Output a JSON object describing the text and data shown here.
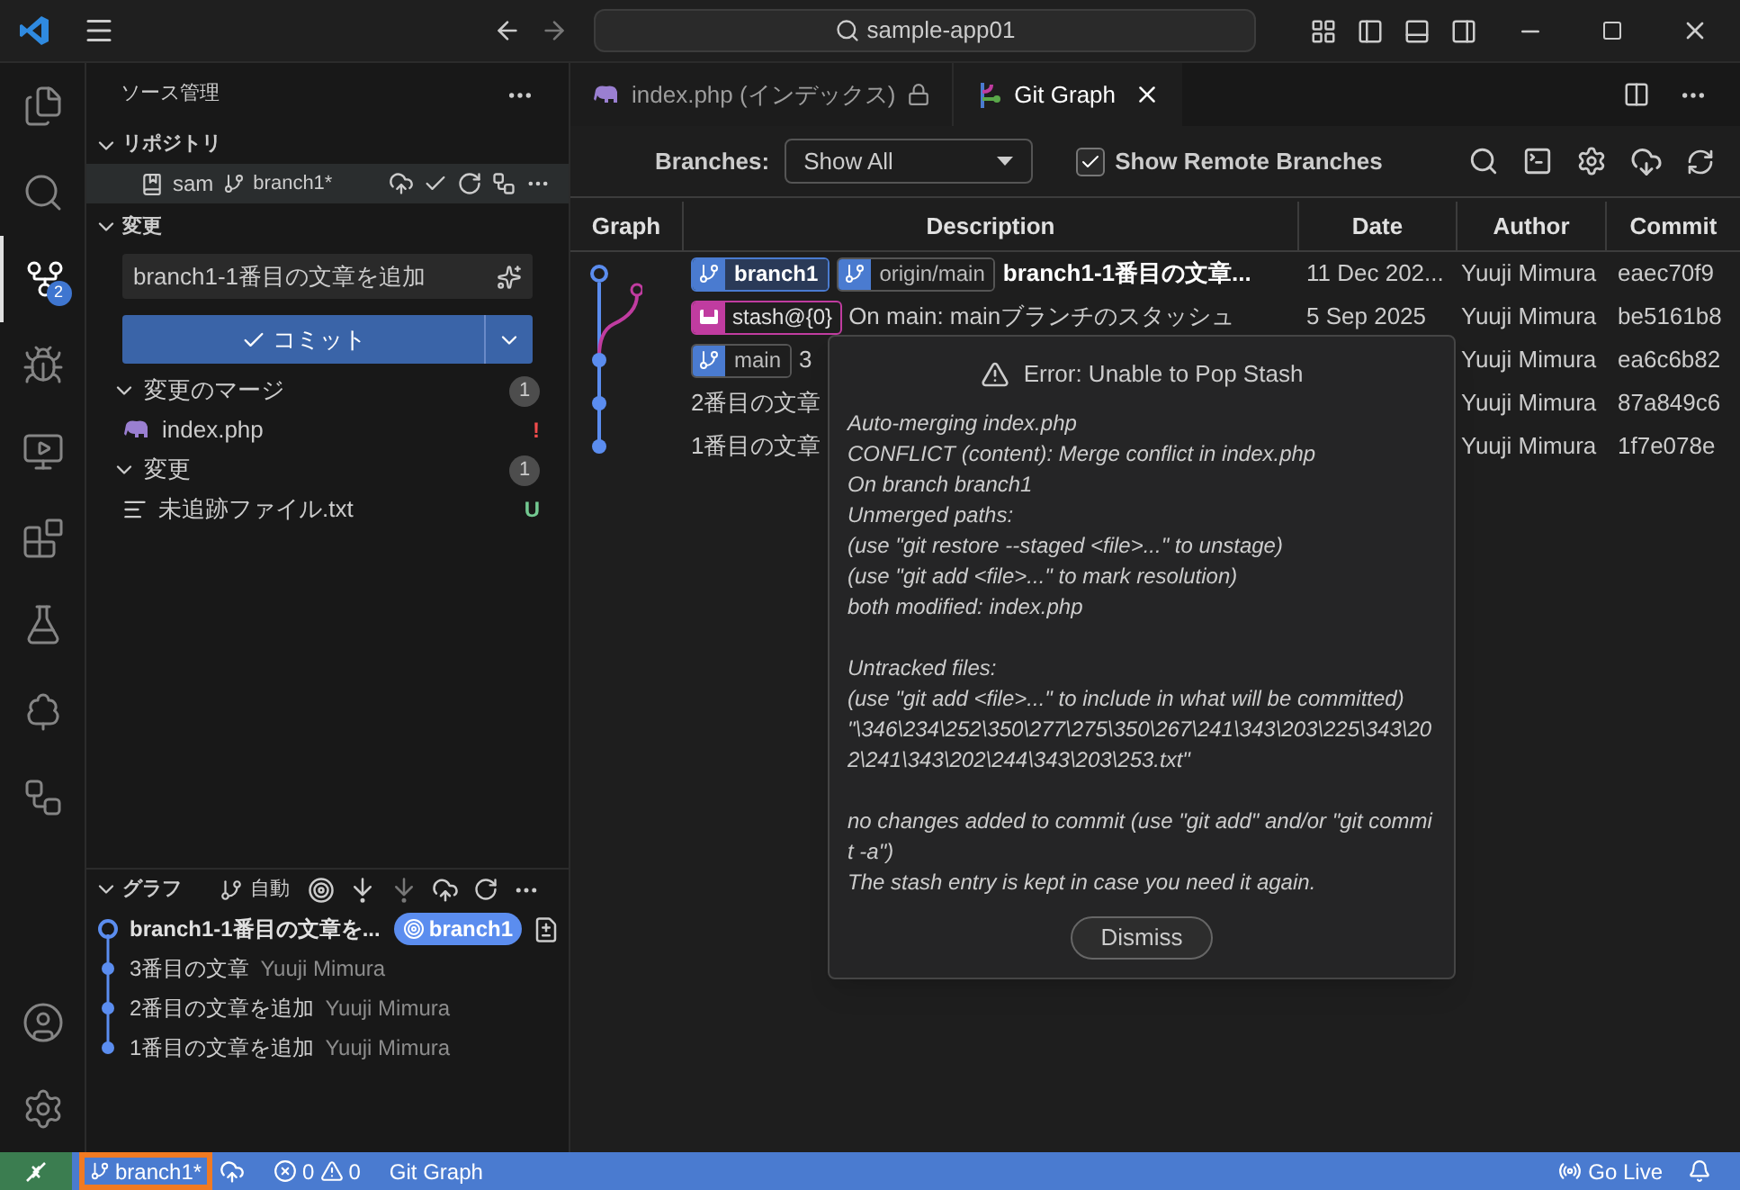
{
  "title_bar": {
    "search": "sample-app01"
  },
  "activity_bar": {
    "items": [
      {
        "kind": "files",
        "selected": false
      },
      {
        "kind": "search",
        "selected": false
      },
      {
        "kind": "source-control",
        "selected": true,
        "badge": "2"
      },
      {
        "kind": "debug",
        "selected": false
      },
      {
        "kind": "remote",
        "selected": false
      },
      {
        "kind": "extensions",
        "selected": false
      },
      {
        "kind": "testing",
        "selected": false
      },
      {
        "kind": "tree",
        "selected": false
      },
      {
        "kind": "diagram",
        "selected": false
      }
    ],
    "bottom": [
      {
        "kind": "account"
      },
      {
        "kind": "settings"
      }
    ]
  },
  "sidebar": {
    "title": "ソース管理",
    "repositories": {
      "label": "リポジトリ",
      "expanded": true,
      "repo": {
        "name": "sam",
        "branch": "branch1*"
      }
    },
    "changes": {
      "label": "変更",
      "expanded": true,
      "message": "branch1-1番目の文章を追加",
      "commit_button": "コミット",
      "groups": [
        {
          "label": "変更のマージ",
          "count": "1",
          "expanded": true,
          "files": [
            {
              "name": "index.php",
              "kind": "php",
              "status": "!",
              "color": "#f14c4c"
            }
          ]
        },
        {
          "label": "変更",
          "count": "1",
          "expanded": true,
          "files": [
            {
              "name": "未追跡ファイル.txt",
              "kind": "text",
              "status": "U",
              "color": "#73c991"
            }
          ]
        }
      ]
    },
    "graph": {
      "label": "グラフ",
      "expanded": true,
      "mode": "自動",
      "commits": [
        {
          "message": "branch1-1番目の文章を...",
          "head": true,
          "ref": "branch1"
        },
        {
          "message": "3番目の文章",
          "head": false,
          "author": "Yuuji Mimura"
        },
        {
          "message": "2番目の文章を追加",
          "head": false,
          "author": "Yuuji Mimura"
        },
        {
          "message": "1番目の文章を追加",
          "head": false,
          "author": "Yuuji Mimura"
        }
      ]
    }
  },
  "editor": {
    "tabs": [
      {
        "label": "index.php (インデックス)",
        "kind": "php",
        "selected": false,
        "locked": true
      },
      {
        "label": "Git Graph",
        "kind": "git-graph",
        "selected": true,
        "locked": false
      }
    ]
  },
  "git_graph": {
    "branches_label": "Branches:",
    "branches_value": "Show All",
    "show_remote": {
      "label": "Show Remote Branches",
      "checked": true
    },
    "columns": [
      "Graph",
      "Description",
      "Date",
      "Author",
      "Commit"
    ],
    "rows": [
      {
        "refs": [
          {
            "kind": "branch",
            "label": "branch1",
            "current": true
          },
          {
            "kind": "branch",
            "label": "origin/main",
            "current": false
          }
        ],
        "description": "branch1-1番目の文章...",
        "bold": true,
        "date": "11 Dec 202...",
        "author": "Yuuji Mimura",
        "commit": "eaec70f9"
      },
      {
        "refs": [
          {
            "kind": "stash",
            "label": "stash@{0}",
            "current": false
          }
        ],
        "description": "On main: mainブランチのスタッシュ",
        "bold": false,
        "date": "5 Sep 2025",
        "author": "Yuuji Mimura",
        "commit": "be5161b8"
      },
      {
        "refs": [
          {
            "kind": "branch",
            "label": "main",
            "current": false
          }
        ],
        "description": "3",
        "bold": false,
        "author": "Yuuji Mimura",
        "commit": "ea6c6b82"
      },
      {
        "description": "2番目の文章",
        "bold": false,
        "author": "Yuuji Mimura",
        "commit": "87a849c6"
      },
      {
        "description": "1番目の文章",
        "bold": false,
        "author": "Yuuji Mimura",
        "commit": "1f7e078e"
      }
    ],
    "dialog": {
      "title": "Error: Unable to Pop Stash",
      "paragraphs": [
        [
          "Auto-merging index.php",
          "CONFLICT (content): Merge conflict in index.php",
          "On branch branch1",
          "Unmerged paths:",
          "(use \"git restore --staged <file>...\" to unstage)",
          "(use \"git add <file>...\" to mark resolution)",
          "both modified: index.php"
        ],
        [
          "Untracked files:",
          "(use \"git add <file>...\" to include in what will be committed)",
          "\"\\346\\234\\252\\350\\277\\275\\350\\267\\241\\343\\203\\225\\343\\202\\241\\343\\202\\244\\343\\203\\253.txt\""
        ],
        [
          "no changes added to commit (use \"git add\" and/or \"git commit -a\")",
          "The stash entry is kept in case you need it again."
        ]
      ],
      "button": "Dismiss"
    }
  },
  "status_bar": {
    "branch": {
      "label": "branch1*",
      "highlighted": true
    },
    "errors": "0",
    "warnings": "0",
    "git_graph": "Git Graph",
    "go_live": "Go Live"
  }
}
